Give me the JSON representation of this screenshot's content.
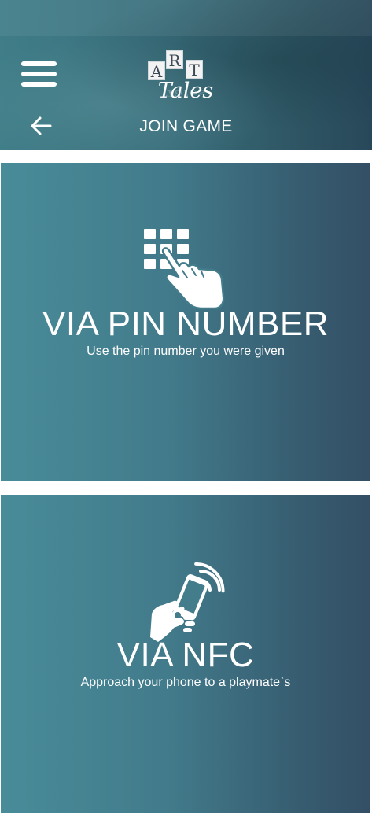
{
  "header": {
    "title": "JOIN GAME",
    "logo": {
      "tiles": [
        "A",
        "R",
        "T"
      ],
      "word": "Tales"
    },
    "menu_icon": "hamburger-menu-icon",
    "back_icon": "arrow-left-icon"
  },
  "options": [
    {
      "title": "VIA PIN NUMBER",
      "subtitle": "Use the pin number you were given",
      "icon": "keypad-touch-icon"
    },
    {
      "title": "VIA NFC",
      "subtitle": "Approach your phone to a playmate`s",
      "icon": "nfc-phone-icon"
    }
  ],
  "colors": {
    "card_gradient_start": "#498c99",
    "card_gradient_end": "#334f65",
    "header_base": "#3a6f7c",
    "text": "#ffffff"
  }
}
